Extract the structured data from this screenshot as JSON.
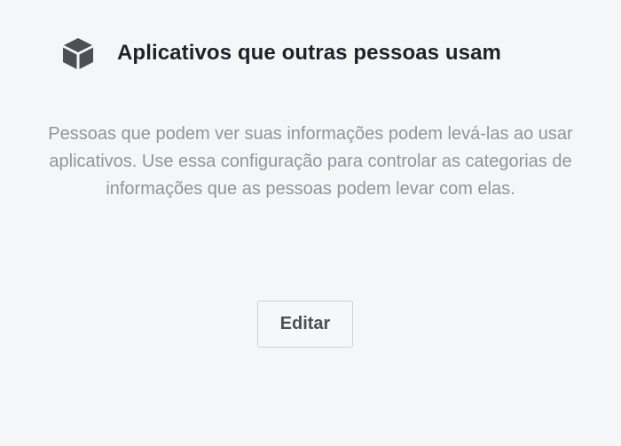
{
  "section": {
    "title": "Aplicativos que outras pessoas usam",
    "icon": "box-icon",
    "description": "Pessoas que podem ver suas informações podem levá-las ao usar aplicativos. Use essa configuração para controlar as categorias de informações que as pessoas podem levar com elas.",
    "edit_label": "Editar"
  },
  "colors": {
    "background": "#f5f6f7",
    "title": "#1d2129",
    "description": "#90949c",
    "icon": "#4b4f56",
    "button_border": "#ced0d4"
  }
}
